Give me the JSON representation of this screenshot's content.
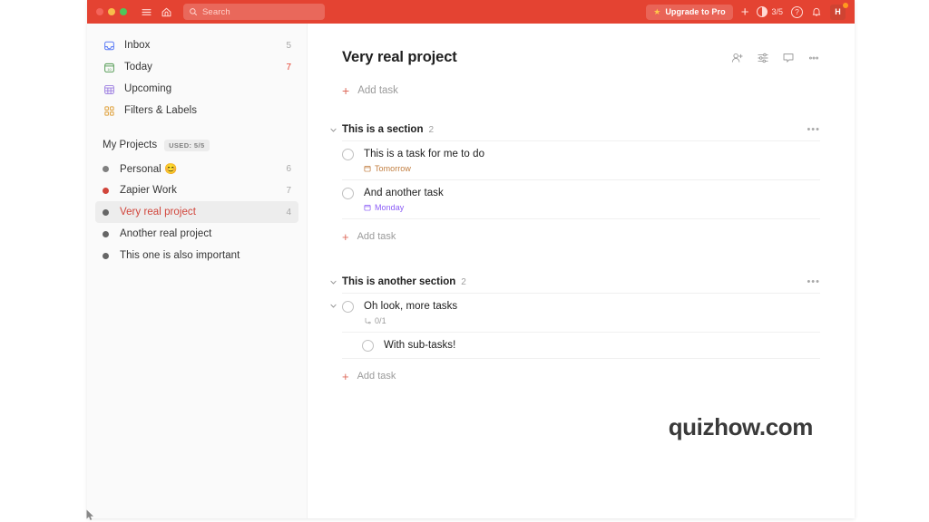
{
  "topbar": {
    "traffic_lights": [
      "close",
      "minimize",
      "maximize"
    ],
    "menu_icon": "hamburger-menu-icon",
    "home_icon": "home-icon",
    "search": {
      "placeholder": "Search",
      "icon": "search-icon"
    },
    "upgrade": {
      "label": "Upgrade to Pro",
      "icon": "star-icon"
    },
    "add_icon": "plus-icon",
    "productivity": {
      "label": "3/5",
      "icon": "productivity-ring-icon"
    },
    "help_icon": "question-mark-icon",
    "notifications_icon": "bell-icon",
    "avatar": {
      "initial": "H",
      "badge": true
    },
    "colors": {
      "bar": "#e44332",
      "accent": "#e44332",
      "badge": "#ff9a1f"
    }
  },
  "sidebar": {
    "nav": [
      {
        "label": "Inbox",
        "count": "5",
        "icon": "inbox-icon",
        "count_accent": false
      },
      {
        "label": "Today",
        "count": "7",
        "icon": "calendar-today-icon",
        "count_accent": true
      },
      {
        "label": "Upcoming",
        "count": "",
        "icon": "calendar-grid-icon",
        "count_accent": false
      },
      {
        "label": "Filters & Labels",
        "count": "",
        "icon": "filters-labels-icon",
        "count_accent": false
      }
    ],
    "projects_header": {
      "title": "My Projects",
      "badge": "USED: 5/5"
    },
    "projects": [
      {
        "label": "Personal 😊",
        "count": "6",
        "dot": "#808080",
        "active": false
      },
      {
        "label": "Zapier Work",
        "count": "7",
        "dot": "#d1453b",
        "active": false
      },
      {
        "label": "Very real project",
        "count": "4",
        "dot": "#666666",
        "active": true
      },
      {
        "label": "Another real project",
        "count": "",
        "dot": "#666666",
        "active": false
      },
      {
        "label": "This one is also important",
        "count": "",
        "dot": "#666666",
        "active": false
      }
    ]
  },
  "main": {
    "title": "Very real project",
    "header_icons": [
      "add-person-icon",
      "view-options-icon",
      "comments-icon",
      "more-options-icon"
    ],
    "add_task_label": "Add task",
    "sections": [
      {
        "name": "This is a section",
        "count": "2",
        "more_icon": "more-options-icon",
        "tasks": [
          {
            "text": "This is a task for me to do",
            "meta_label": "Tomorrow",
            "meta_icon": "calendar-icon",
            "meta_color": "orange",
            "indent": false,
            "expandable": false
          },
          {
            "text": "And another task",
            "meta_label": "Monday",
            "meta_icon": "calendar-icon",
            "meta_color": "purple",
            "indent": false,
            "expandable": false
          }
        ],
        "add_task_label": "Add task"
      },
      {
        "name": "This is another section",
        "count": "2",
        "more_icon": "more-options-icon",
        "tasks": [
          {
            "text": "Oh look, more tasks",
            "meta_label": "0/1",
            "meta_icon": "subtask-icon",
            "meta_color": "gray",
            "indent": false,
            "expandable": true
          },
          {
            "text": "With sub-tasks!",
            "meta_label": "",
            "meta_icon": "",
            "meta_color": "gray",
            "indent": true,
            "expandable": false
          }
        ],
        "add_task_label": "Add task"
      }
    ]
  },
  "watermark": "quizhow.com"
}
